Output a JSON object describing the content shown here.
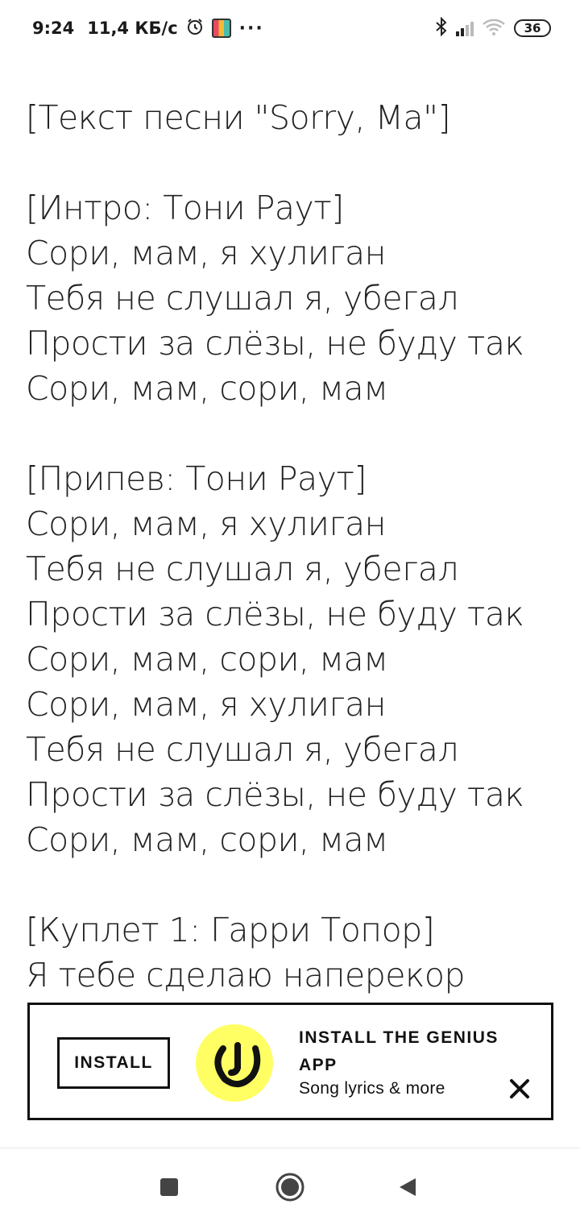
{
  "status_bar": {
    "time": "9:24",
    "speed": "11,4 КБ/с",
    "alarm_icon": "alarm-clock-icon",
    "more": "···",
    "battery": "36"
  },
  "lyrics": {
    "lines": [
      "[Текст песни \"Sorry, Ma\"]",
      "",
      "[Интро: Тони Раут]",
      "Сори, мам, я хулиган",
      "Тебя не слушал я, убегал",
      "Прости за слёзы, не буду так",
      "Сори, мам, сори, мам",
      "",
      "[Припев: Тони Раут]",
      "Сори, мам, я хулиган",
      "Тебя не слушал я, убегал",
      "Прости за слёзы, не буду так",
      "Сори, мам, сори, мам",
      "Сори, мам, я хулиган",
      "Тебя не слушал я, убегал",
      "Прости за слёзы, не буду так",
      "Сори, мам, сори, мам",
      "",
      "[Куплет 1: Гарри Топор]",
      "Я тебе сделаю наперекор"
    ]
  },
  "banner": {
    "install_label": "INSTALL",
    "title": "INSTALL THE GENIUS APP",
    "subtitle": "Song lyrics & more",
    "logo_icon": "genius-logo-icon",
    "close_icon": "close-icon",
    "colors": {
      "logo_bg": "#ffff64",
      "border": "#111111"
    }
  },
  "nav_bar": {
    "recents_icon": "square-recents-icon",
    "home_icon": "home-circle-icon",
    "back_icon": "back-triangle-icon"
  }
}
